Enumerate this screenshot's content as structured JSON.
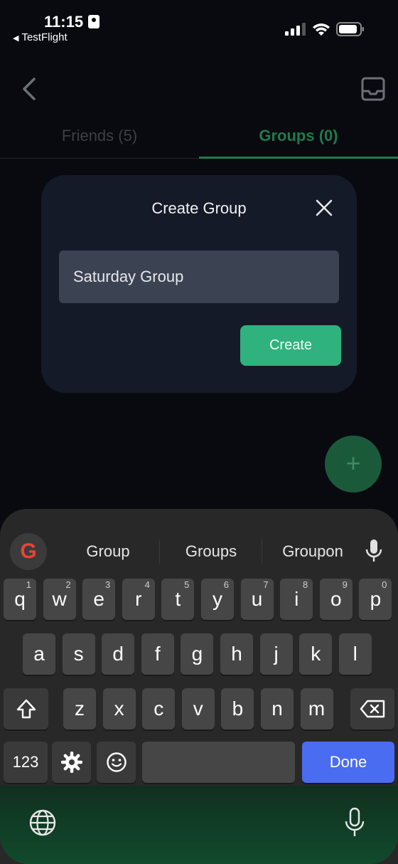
{
  "status_bar": {
    "time": "11:15",
    "back_app": "TestFlight"
  },
  "tabs": [
    {
      "label": "Friends (5)",
      "active": false
    },
    {
      "label": "Groups (0)",
      "active": true
    }
  ],
  "dialog": {
    "title": "Create Group",
    "input_value": "Saturday Group",
    "create_label": "Create"
  },
  "fab": {
    "icon": "plus-icon",
    "symbol": "+"
  },
  "keyboard": {
    "suggestions": [
      "Group",
      "Groups",
      "Groupon"
    ],
    "row1": [
      {
        "k": "q",
        "n": "1"
      },
      {
        "k": "w",
        "n": "2"
      },
      {
        "k": "e",
        "n": "3"
      },
      {
        "k": "r",
        "n": "4"
      },
      {
        "k": "t",
        "n": "5"
      },
      {
        "k": "y",
        "n": "6"
      },
      {
        "k": "u",
        "n": "7"
      },
      {
        "k": "i",
        "n": "8"
      },
      {
        "k": "o",
        "n": "9"
      },
      {
        "k": "p",
        "n": "0"
      }
    ],
    "row2": [
      "a",
      "s",
      "d",
      "f",
      "g",
      "h",
      "j",
      "k",
      "l"
    ],
    "row3": [
      "z",
      "x",
      "c",
      "v",
      "b",
      "n",
      "m"
    ],
    "numbers_label": "123",
    "done_label": "Done"
  },
  "colors": {
    "accent_green": "#2fb27d",
    "tab_active": "#1f7a4d",
    "done_blue": "#4a6cf0",
    "dialog_bg": "#151a28"
  }
}
